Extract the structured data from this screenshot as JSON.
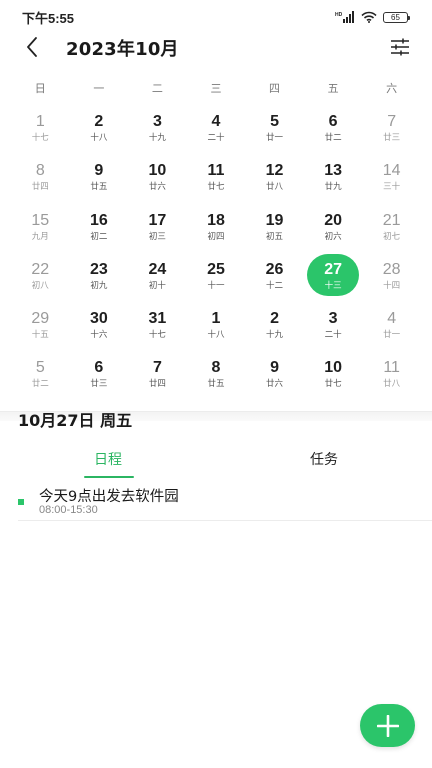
{
  "status": {
    "time": "下午5:55",
    "signal_label": "HD",
    "battery": "65"
  },
  "header": {
    "title": "2023年10月"
  },
  "weekdays": [
    "日",
    "一",
    "二",
    "三",
    "四",
    "五",
    "六"
  ],
  "calendar": {
    "weeks": [
      [
        {
          "d": "1",
          "l": "十七"
        },
        {
          "d": "2",
          "l": "十八"
        },
        {
          "d": "3",
          "l": "十九"
        },
        {
          "d": "4",
          "l": "二十"
        },
        {
          "d": "5",
          "l": "廿一"
        },
        {
          "d": "6",
          "l": "廿二"
        },
        {
          "d": "7",
          "l": "廿三"
        }
      ],
      [
        {
          "d": "8",
          "l": "廿四"
        },
        {
          "d": "9",
          "l": "廿五"
        },
        {
          "d": "10",
          "l": "廿六"
        },
        {
          "d": "11",
          "l": "廿七"
        },
        {
          "d": "12",
          "l": "廿八"
        },
        {
          "d": "13",
          "l": "廿九"
        },
        {
          "d": "14",
          "l": "三十"
        }
      ],
      [
        {
          "d": "15",
          "l": "九月"
        },
        {
          "d": "16",
          "l": "初二"
        },
        {
          "d": "17",
          "l": "初三"
        },
        {
          "d": "18",
          "l": "初四"
        },
        {
          "d": "19",
          "l": "初五"
        },
        {
          "d": "20",
          "l": "初六"
        },
        {
          "d": "21",
          "l": "初七"
        }
      ],
      [
        {
          "d": "22",
          "l": "初八"
        },
        {
          "d": "23",
          "l": "初九"
        },
        {
          "d": "24",
          "l": "初十"
        },
        {
          "d": "25",
          "l": "十一"
        },
        {
          "d": "26",
          "l": "十二"
        },
        {
          "d": "27",
          "l": "十三"
        },
        {
          "d": "28",
          "l": "十四"
        }
      ],
      [
        {
          "d": "29",
          "l": "十五"
        },
        {
          "d": "30",
          "l": "十六"
        },
        {
          "d": "31",
          "l": "十七"
        },
        {
          "d": "1",
          "l": "十八"
        },
        {
          "d": "2",
          "l": "十九"
        },
        {
          "d": "3",
          "l": "二十"
        },
        {
          "d": "4",
          "l": "廿一"
        }
      ],
      [
        {
          "d": "5",
          "l": "廿二"
        },
        {
          "d": "6",
          "l": "廿三"
        },
        {
          "d": "7",
          "l": "廿四"
        },
        {
          "d": "8",
          "l": "廿五"
        },
        {
          "d": "9",
          "l": "廿六"
        },
        {
          "d": "10",
          "l": "廿七"
        },
        {
          "d": "11",
          "l": "廿八"
        }
      ]
    ],
    "muted": [
      [
        0,
        0
      ],
      [
        0,
        6
      ],
      [
        1,
        0
      ],
      [
        1,
        6
      ],
      [
        2,
        0
      ],
      [
        2,
        6
      ],
      [
        3,
        0
      ],
      [
        3,
        6
      ],
      [
        4,
        0
      ],
      [
        4,
        6
      ],
      [
        5,
        0
      ],
      [
        5,
        6
      ]
    ],
    "selected": [
      3,
      5
    ]
  },
  "selected_date": {
    "label": "10月27日 周五"
  },
  "tabs": [
    {
      "label": "日程"
    },
    {
      "label": "任务"
    }
  ],
  "events": [
    {
      "title": "今天9点出发去软件园",
      "time": "08:00-15:30"
    }
  ],
  "colors": {
    "accent": "#2bc56a",
    "accent_text": "#2bb562"
  },
  "icons": {
    "back": "back-arrow-icon",
    "filter": "filter-sliders-icon",
    "add": "plus-icon"
  }
}
